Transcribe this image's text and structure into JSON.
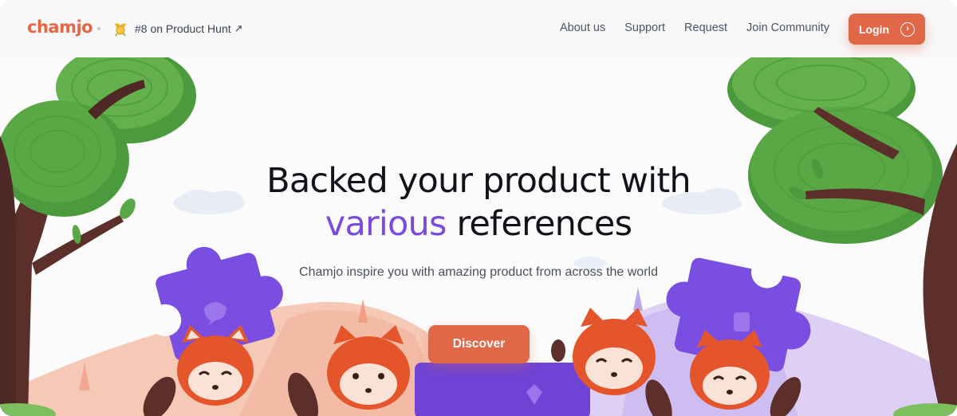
{
  "brand": {
    "logo": "chamjo"
  },
  "badge": {
    "text": "#8 on Product Hunt",
    "arrow": "↗"
  },
  "nav": {
    "links": [
      "About us",
      "Support",
      "Request",
      "Join Community"
    ],
    "login_label": "Login",
    "login_icon": "chevron-right-circle-icon"
  },
  "hero": {
    "title_line1": "Backed your product with",
    "title_accent": "various",
    "title_rest": " references",
    "subtitle": "Chamjo inspire you with amazing product from across the world",
    "cta_label": "Discover"
  },
  "colors": {
    "brand": "#e06747",
    "accent": "#7b4cdc",
    "tree_green": "#5aa845",
    "puzzle_purple": "#7a4ee0"
  }
}
